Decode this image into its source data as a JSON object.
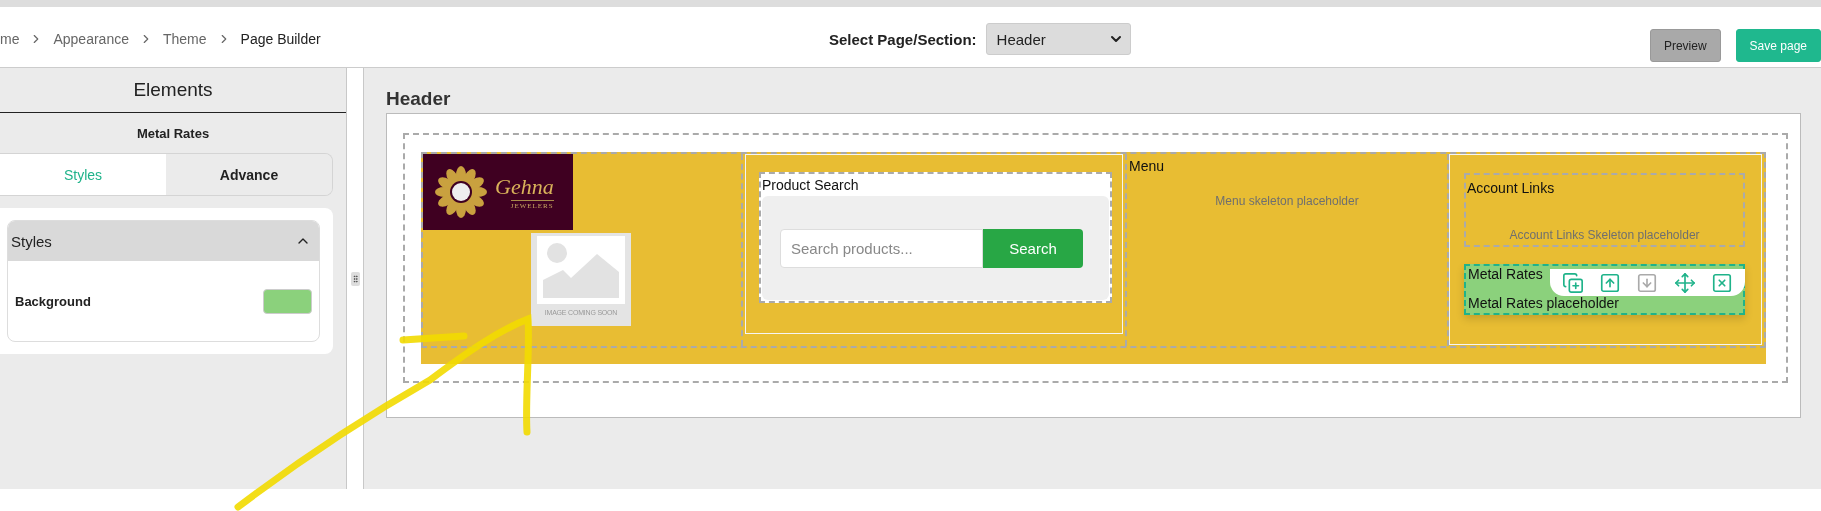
{
  "breadcrumb": [
    {
      "label": "me"
    },
    {
      "label": "Appearance"
    },
    {
      "label": "Theme"
    },
    {
      "label": "Page Builder"
    }
  ],
  "section_select": {
    "label": "Select Page/Section:",
    "value": "Header"
  },
  "buttons": [
    {
      "label": "Preview",
      "kind": "secondary"
    },
    {
      "label": "Save page",
      "kind": "primary"
    }
  ],
  "sidebar": {
    "title": "Elements",
    "element": "Metal Rates",
    "tabs": [
      {
        "label": "Styles",
        "selected": true
      },
      {
        "label": "Advance",
        "selected": false
      }
    ],
    "section": {
      "title": "Styles",
      "expanded": true,
      "fields": [
        {
          "label": "Background",
          "color": "#8bd17c"
        }
      ]
    }
  },
  "canvas": {
    "title": "Header",
    "columns": [
      {
        "kind": "logo",
        "logo_name": "Gehna",
        "logo_tagline": "JEWELERS",
        "image_caption": "IMAGE COMING SOON"
      },
      {
        "kind": "search",
        "title": "Product Search",
        "placeholder": "Search products...",
        "button": "Search"
      },
      {
        "kind": "menu",
        "title": "Menu",
        "placeholder": "Menu skeleton placeholder"
      },
      {
        "kind": "account",
        "title": "Account Links",
        "placeholder": "Account Links Skeleton placeholder",
        "block": {
          "title": "Metal Rates",
          "text": "Metal Rates placeholder",
          "actions": [
            {
              "kind": "duplicate",
              "disabled": false
            },
            {
              "kind": "up",
              "disabled": false
            },
            {
              "kind": "down",
              "disabled": true
            },
            {
              "kind": "move",
              "disabled": false
            },
            {
              "kind": "remove",
              "disabled": false
            }
          ]
        }
      }
    ]
  }
}
